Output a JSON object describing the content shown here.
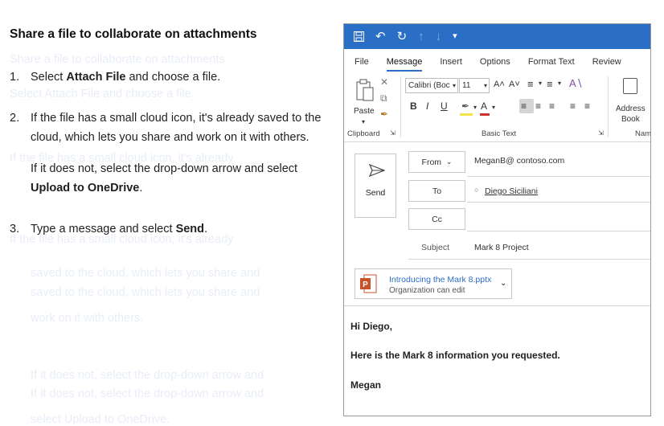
{
  "instructions": {
    "title": "Share a file to collaborate on attachments",
    "step1_num": "1.",
    "step1_a": "Select ",
    "step1_b": "Attach File",
    "step1_c": " and choose a file.",
    "step2_num": "2.",
    "step2_text": "If the file has a small cloud icon, it's already saved to the cloud, which lets you share and work on it with others.",
    "step2_sub_a": "If it does not, select the drop-down arrow and select ",
    "step2_sub_b": "Upload to OneDrive",
    "step2_sub_c": ".",
    "step3_num": "3.",
    "step3_a": "Type a message and select ",
    "step3_b": "Send",
    "step3_c": "."
  },
  "qat": {
    "save_glyph": "💾",
    "undo_glyph": "↶",
    "redo_glyph": "↻",
    "up_glyph": "↑",
    "down_glyph": "↓",
    "more_glyph": "▾"
  },
  "tabs": [
    "File",
    "Message",
    "Insert",
    "Options",
    "Format Text",
    "Review"
  ],
  "ribbon": {
    "paste_label": "Paste",
    "clipboard_label": "Clipboard",
    "font_name": "Calibri (Boc",
    "font_size": "11",
    "basic_text_label": "Basic Text",
    "address_book_label_1": "Address",
    "address_book_label_2": "Book",
    "names_label": "Nam",
    "bold": "B",
    "italic": "I",
    "underline": "U",
    "grow_font": "A˄",
    "shrink_font": "A˅"
  },
  "compose": {
    "send_label": "Send",
    "from_label": "From",
    "from_value": "MeganB@ contoso.com",
    "to_label": "To",
    "to_value": "Diego Siciliani",
    "cc_label": "Cc",
    "subject_label": "Subject",
    "subject_value": "Mark 8 Project",
    "attachment_name": "Introducing the Mark 8.pptx",
    "attachment_permission": "Organization can edit",
    "body_greeting": "Hi Diego,",
    "body_text": "Here is the Mark 8 information you requested.",
    "body_signature": "Megan"
  },
  "colors": {
    "accent": "#2b6ec6",
    "ppt_orange": "#c8512c"
  }
}
